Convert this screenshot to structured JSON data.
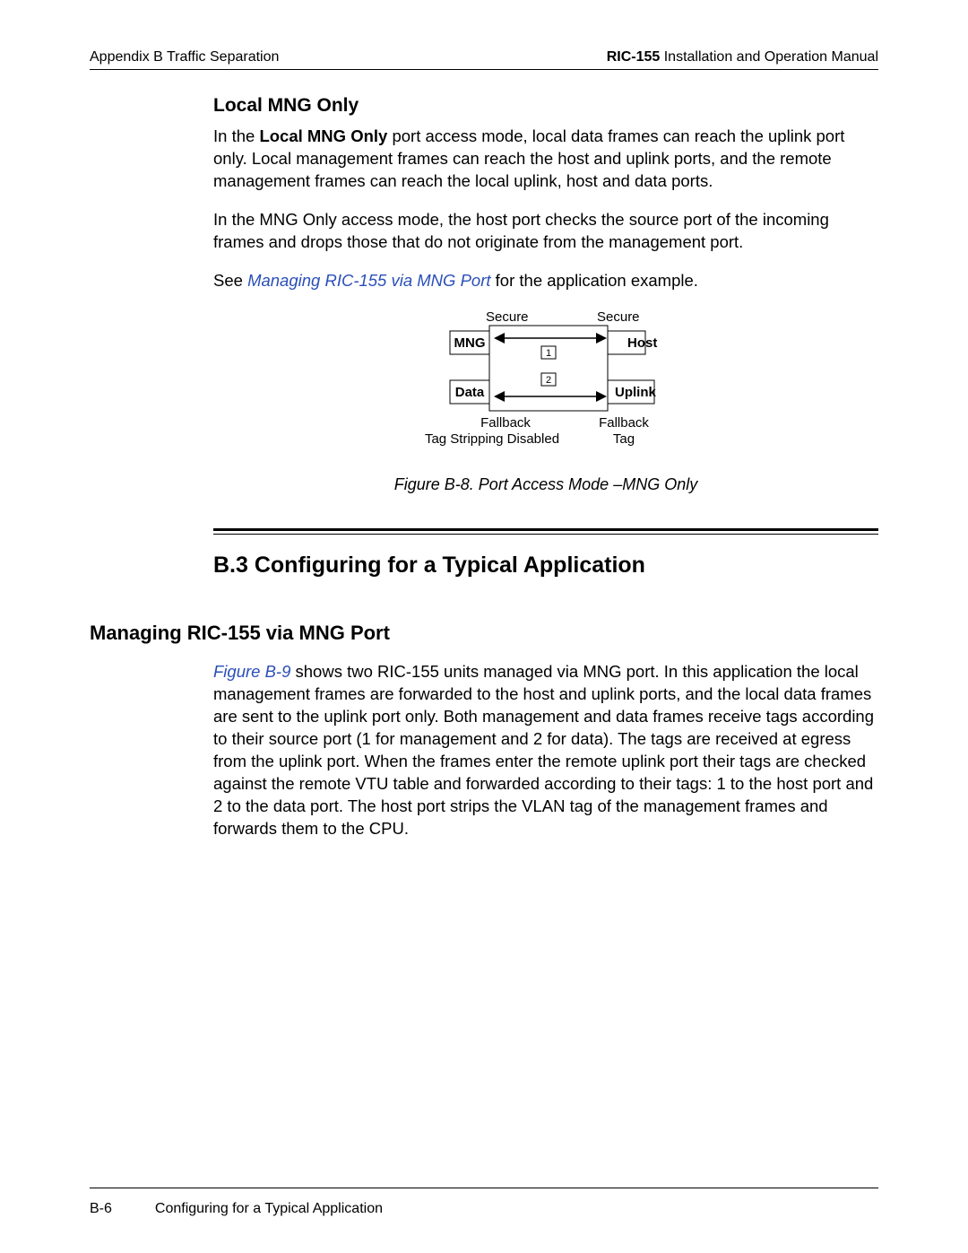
{
  "header": {
    "left": "Appendix B  Traffic Separation",
    "right_bold": "RIC-155",
    "right_rest": " Installation and Operation Manual"
  },
  "localMng": {
    "title": "Local MNG Only",
    "p1_a": "In the ",
    "p1_bold": "Local MNG Only",
    "p1_b": " port access mode, local data frames can reach the uplink port only. Local management frames can reach the host and uplink ports, and the remote management frames can reach the local uplink, host and data ports.",
    "p2": "In the MNG Only access mode, the host port checks the source port of the incoming frames and drops those that do not originate from the management port.",
    "p3_a": "See ",
    "p3_link": "Managing RIC-155 via MNG Port",
    "p3_b": " for the application example."
  },
  "diagram": {
    "secure_l": "Secure",
    "secure_r": "Secure",
    "mng": "MNG",
    "host": "Host",
    "data": "Data",
    "uplink": "Uplink",
    "n1": "1",
    "n2": "2",
    "fallback_l1": "Fallback",
    "fallback_l2": "Tag Stripping Disabled",
    "fallback_r1": "Fallback",
    "fallback_r2": "Tag",
    "caption": "Figure B-8.  Port Access Mode –MNG Only"
  },
  "section": {
    "title": "B.3  Configuring for a Typical Application",
    "sub": "Managing RIC-155 via MNG Port",
    "p_link": "Figure B-9",
    "p_rest": " shows two RIC-155 units managed via MNG port. In this application the local management frames are forwarded to the host and uplink ports, and the local data frames are sent to the uplink port only. Both management and data frames receive tags according to their source port (1 for management and 2 for data). The tags are received at egress from the uplink port. When the frames enter the remote uplink port their tags are checked against the remote VTU table and forwarded according to their tags: 1 to the host port and 2 to the data port. The host port strips the VLAN tag of the management frames and forwards them to the CPU."
  },
  "footer": {
    "page": "B-6",
    "title": "Configuring for a Typical Application"
  }
}
